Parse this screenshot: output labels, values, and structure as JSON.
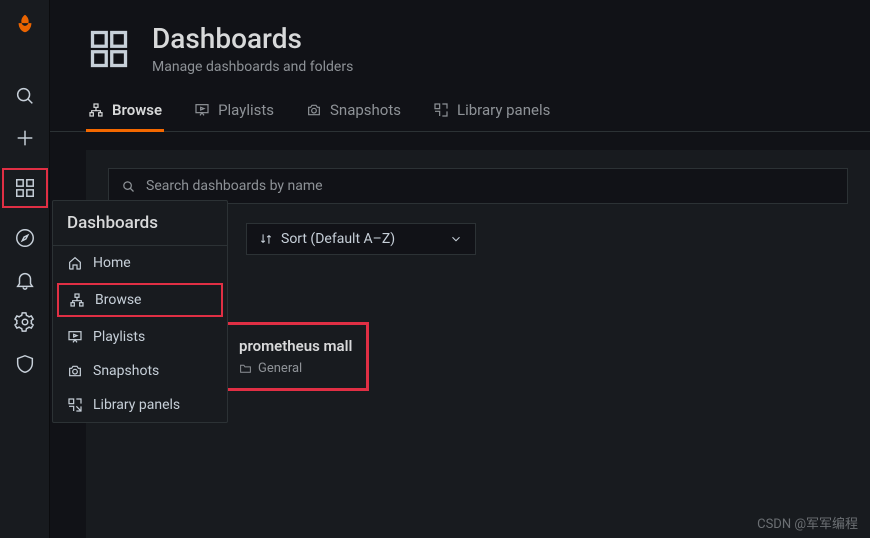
{
  "header": {
    "title": "Dashboards",
    "subtitle": "Manage dashboards and folders"
  },
  "sidebar": {
    "heading": "Dashboards",
    "items": [
      {
        "label": "Home"
      },
      {
        "label": "Browse"
      },
      {
        "label": "Playlists"
      },
      {
        "label": "Snapshots"
      },
      {
        "label": "Library panels"
      }
    ]
  },
  "tabs": [
    {
      "label": "Browse",
      "active": true
    },
    {
      "label": "Playlists",
      "active": false
    },
    {
      "label": "Snapshots",
      "active": false
    },
    {
      "label": "Library panels",
      "active": false
    }
  ],
  "search": {
    "placeholder": "Search dashboards by name"
  },
  "sort": {
    "label": "Sort (Default A–Z)"
  },
  "list": {
    "folder": "General",
    "dashboard": {
      "title": "prometheus mall",
      "folder": "General"
    }
  },
  "watermark": "CSDN @军军编程"
}
